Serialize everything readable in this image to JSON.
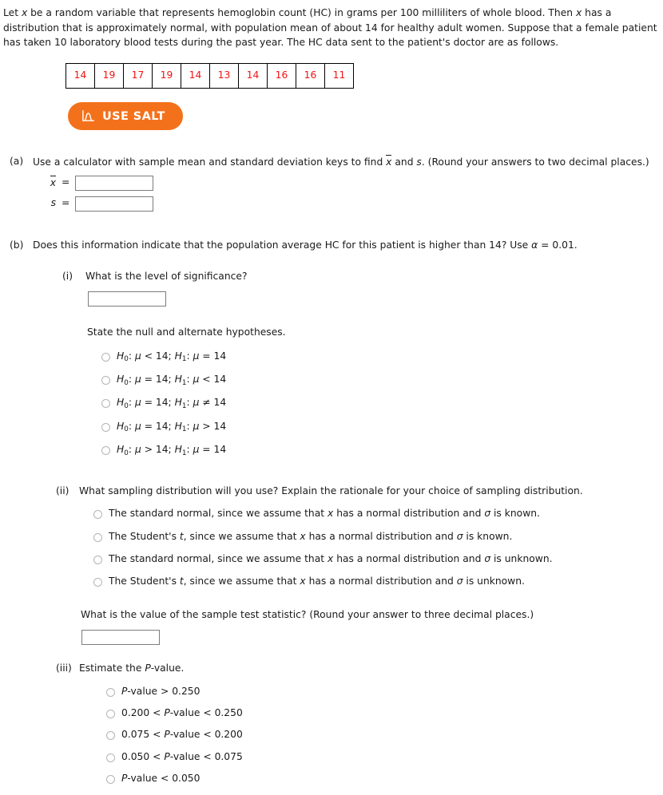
{
  "intro": {
    "line1_a": "Let ",
    "line1_var": "x",
    "line1_b": " be a random variable that represents hemoglobin count (HC) in grams per 100 milliliters of whole blood. Then ",
    "line1_var2": "x",
    "line1_c": " has a distribution that is approximately normal, with population mean of about 14 for healthy adult women. Suppose that a female patient has taken 10 laboratory blood tests during the past year. The HC data sent to the patient's doctor are as follows."
  },
  "data_table": {
    "values": [
      14,
      19,
      17,
      19,
      14,
      13,
      14,
      16,
      16,
      11
    ],
    "text_color": "#f01414",
    "border_color": "#000000"
  },
  "salt_button": {
    "label": "USE SALT",
    "icon": "normal-distribution-curve-icon",
    "background": "#f4711b",
    "text_color": "#ffffff"
  },
  "part_a": {
    "label": "(a)",
    "prompt_a": "Use a calculator with sample mean and standard deviation keys to find ",
    "prompt_xbar": "x",
    "prompt_b": " and ",
    "prompt_s": "s",
    "prompt_c": ". (Round your answers to two decimal places.)",
    "xbar_symbol": "x",
    "s_symbol": "s",
    "equals": "=",
    "xbar_value": "",
    "s_value": ""
  },
  "part_b": {
    "label": "(b)",
    "prompt_a": "Does this information indicate that the population average HC for this patient is higher than 14? Use ",
    "prompt_alpha": "α",
    "prompt_b": " = 0.01.",
    "sub_i": {
      "label": "(i)",
      "question": "What is the level of significance?",
      "answer_value": "",
      "state_heading": "State the null and alternate hypotheses.",
      "options": [
        "H₀: μ < 14; H₁: μ = 14",
        "H₀: μ = 14; H₁: μ < 14",
        "H₀: μ = 14; H₁: μ ≠ 14",
        "H₀: μ = 14; H₁: μ > 14",
        "H₀: μ > 14; H₁: μ = 14"
      ],
      "options_parts": [
        {
          "h0_sub": "0",
          "h0_rel": "< 14;",
          "h1_sub": "1",
          "h1_rel": "= 14"
        },
        {
          "h0_sub": "0",
          "h0_rel": "= 14;",
          "h1_sub": "1",
          "h1_rel": "< 14"
        },
        {
          "h0_sub": "0",
          "h0_rel": "= 14;",
          "h1_sub": "1",
          "h1_rel": "≠ 14"
        },
        {
          "h0_sub": "0",
          "h0_rel": "= 14;",
          "h1_sub": "1",
          "h1_rel": "> 14"
        },
        {
          "h0_sub": "0",
          "h0_rel": "> 14;",
          "h1_sub": "1",
          "h1_rel": "= 14"
        }
      ]
    },
    "sub_ii": {
      "label": "(ii)",
      "question": "What sampling distribution will you use? Explain the rationale for your choice of sampling distribution.",
      "options": [
        {
          "pre": "The standard normal, since we assume that ",
          "var": "x",
          "mid": " has a normal distribution and ",
          "sigma": "σ",
          "post": " is known."
        },
        {
          "pre": "The Student's ",
          "var": "t",
          "mid": ", since we assume that ",
          "var2": "x",
          "mid2": " has a normal distribution and ",
          "sigma": "σ",
          "post": " is known."
        },
        {
          "pre": "The standard normal, since we assume that ",
          "var": "x",
          "mid": " has a normal distribution and ",
          "sigma": "σ",
          "post": " is unknown."
        },
        {
          "pre": "The Student's ",
          "var": "t",
          "mid": ", since we assume that ",
          "var2": "x",
          "mid2": " has a normal distribution and ",
          "sigma": "σ",
          "post": " is unknown."
        }
      ],
      "options_plain": [
        "The standard normal, since we assume that x has a normal distribution and σ is known.",
        "The Student's t, since we assume that x has a normal distribution and σ is known.",
        "The standard normal, since we assume that x has a normal distribution and σ is unknown.",
        "The Student's t, since we assume that x has a normal distribution and σ is unknown."
      ],
      "test_statistic_question": "What is the value of the sample test statistic? (Round your answer to three decimal places.)",
      "test_statistic_value": ""
    },
    "sub_iii": {
      "label": "(iii)",
      "question_pre": "Estimate the ",
      "question_p": "P",
      "question_post": "-value.",
      "options": [
        "P-value > 0.250",
        "0.200 < P-value < 0.250",
        "0.075 < P-value < 0.200",
        "0.050 < P-value < 0.075",
        "P-value < 0.050"
      ],
      "options_parts": [
        {
          "lead": "",
          "p": "P",
          "tail": "-value > 0.250"
        },
        {
          "lead": "0.200 < ",
          "p": "P",
          "tail": "-value < 0.250"
        },
        {
          "lead": "0.075 < ",
          "p": "P",
          "tail": "-value < 0.200"
        },
        {
          "lead": "0.050 < ",
          "p": "P",
          "tail": "-value < 0.075"
        },
        {
          "lead": "",
          "p": "P",
          "tail": "-value < 0.050"
        }
      ]
    }
  }
}
